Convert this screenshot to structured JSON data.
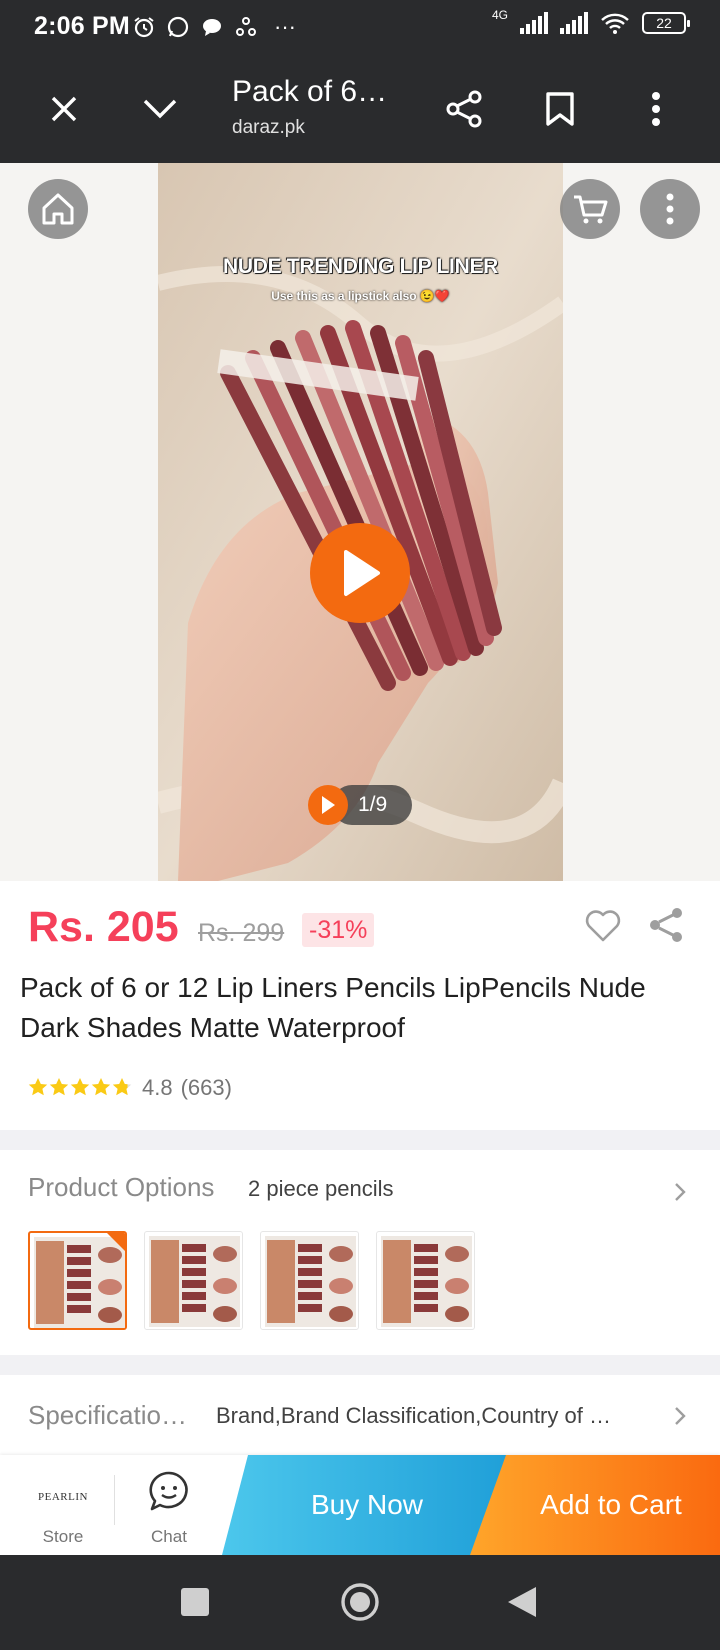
{
  "status_bar": {
    "time": "2:06 PM",
    "network": "4G",
    "battery": "22",
    "more": "···"
  },
  "browser": {
    "title": "Pack of 6…",
    "url": "daraz.pk",
    "icons": [
      "close-icon",
      "chevron-down-icon",
      "share-icon",
      "bookmark-icon",
      "more-vert-icon"
    ]
  },
  "media": {
    "overlay_title": "NUDE TRENDING LIP LINER",
    "overlay_subtitle": "Use this as a lipstick also 😉❤️",
    "counter": "1/9",
    "icons": [
      "home-icon",
      "cart-icon",
      "more-icon",
      "play-icon"
    ]
  },
  "product": {
    "price": "Rs. 205",
    "original_price": "Rs. 299",
    "discount": "-31%",
    "title": "Pack of 6 or 12 Lip Liners Pencils LipPencils Nude Dark Shades Matte Waterproof",
    "rating": "4.8",
    "review_count": "(663)",
    "stars": 4.8
  },
  "options": {
    "label": "Product Options",
    "value": "2 piece pencils",
    "thumbnail_count": 4
  },
  "specifications": {
    "label": "Specificatio…",
    "value": "Brand,Brand Classification,Country of …"
  },
  "actions": {
    "store_logo": "PEARLIN",
    "store_label": "Store",
    "chat_label": "Chat",
    "buy_now": "Buy Now",
    "add_to_cart": "Add to Cart"
  },
  "colors": {
    "price": "#f5405a",
    "accent_orange": "#f36a10",
    "buy_now_blue": "#1f9fd8",
    "dark_bar": "#2a2b2d"
  }
}
